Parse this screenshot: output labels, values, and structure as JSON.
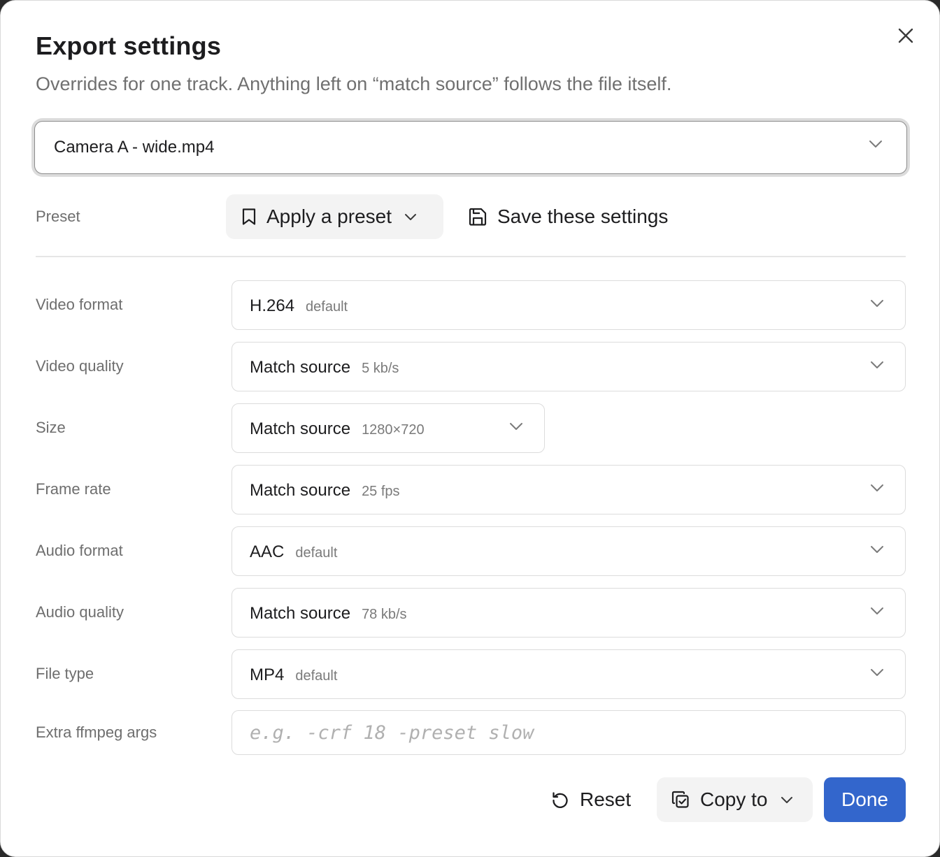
{
  "dialog": {
    "title": "Export settings",
    "subtitle": "Overrides for one track. Anything left on “match source” follows the file itself.",
    "close_icon": "close-icon"
  },
  "track": {
    "selected": "Camera A - wide.mp4"
  },
  "preset": {
    "label": "Preset",
    "apply_label": "Apply a preset",
    "apply_icon": "bookmark-icon",
    "save_label": "Save these settings",
    "save_icon": "floppy-disk-icon"
  },
  "fields": {
    "video_format": {
      "label": "Video format",
      "value": "H.264",
      "hint": "default"
    },
    "video_quality": {
      "label": "Video quality",
      "value": "Match source",
      "hint": "5 kb/s"
    },
    "size": {
      "label": "Size",
      "value": "Match source",
      "hint": "1280×720"
    },
    "frame_rate": {
      "label": "Frame rate",
      "value": "Match source",
      "hint": "25 fps"
    },
    "audio_format": {
      "label": "Audio format",
      "value": "AAC",
      "hint": "default"
    },
    "audio_quality": {
      "label": "Audio quality",
      "value": "Match source",
      "hint": "78 kb/s"
    },
    "file_type": {
      "label": "File type",
      "value": "MP4",
      "hint": "default"
    },
    "extra_args": {
      "label": "Extra ffmpeg args",
      "value": "",
      "placeholder": "e.g. -crf 18 -preset slow"
    }
  },
  "footer": {
    "reset_label": "Reset",
    "reset_icon": "reset-icon",
    "copy_label": "Copy to",
    "copy_icon": "copy-icon",
    "done_label": "Done"
  },
  "colors": {
    "primary": "#3366cc",
    "secondary_bg": "#f3f3f3",
    "muted_text": "#6e6e6e",
    "border": "#dcdcdc"
  }
}
